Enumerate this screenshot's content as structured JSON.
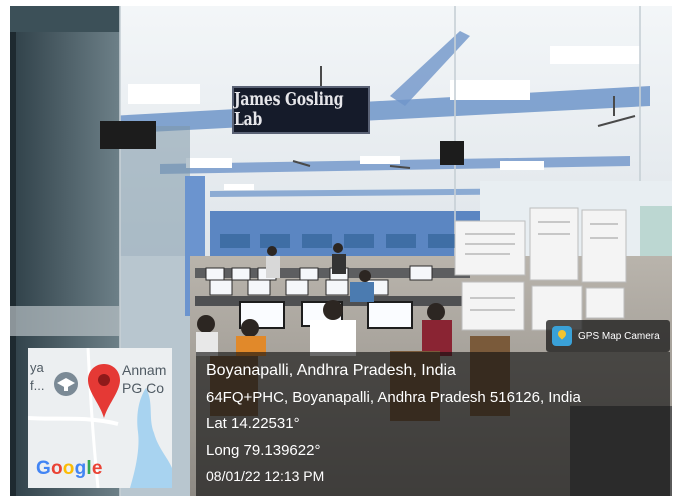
{
  "photo": {
    "lab_sign": "James Gosling Lab",
    "colors": {
      "ceiling": "#eef2f5",
      "wall_blue": "#5b86c2",
      "floor": "#a8a29a"
    }
  },
  "gps_badge": {
    "app_name": "GPS Map Camera",
    "icon": "gps-map-camera-app-icon"
  },
  "location": {
    "place": "Boyanapalli, Andhra Pradesh, India",
    "address": "64FQ+PHC, Boyanapalli, Andhra Pradesh 516126, India",
    "lat": "Lat 14.22531°",
    "long": "Long 79.139622°",
    "datetime": "08/01/22 12:13 PM"
  },
  "map": {
    "label_left_1": "ya",
    "label_left_2": "f...",
    "label_right_1": "Annam",
    "label_right_2": "PG Co",
    "provider": "Google",
    "pin_color": "#e53935",
    "water_color": "#a8d3f0",
    "icons": [
      "graduation-cap-icon",
      "map-pin-icon"
    ]
  }
}
